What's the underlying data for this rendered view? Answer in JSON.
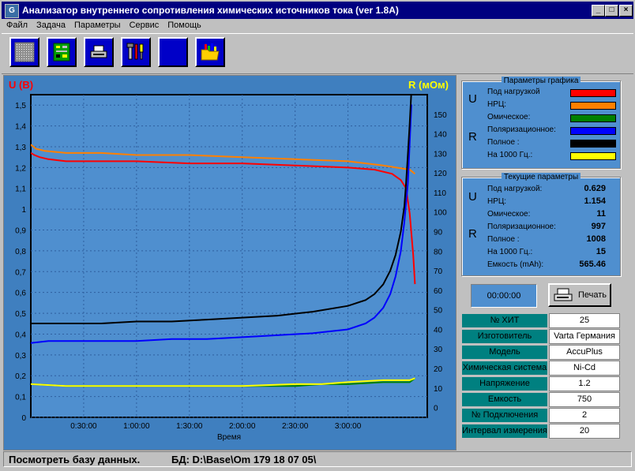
{
  "window": {
    "title": "Анализатор внутреннего сопротивления химических источников тока (ver 1.8A)",
    "min_glyph": "_",
    "max_glyph": "□",
    "close_glyph": "×"
  },
  "menu": [
    "Файл",
    "Задача",
    "Параметры",
    "Сервис",
    "Помощь"
  ],
  "toolbar": {
    "icons": [
      "pattern-icon",
      "circuit-board-icon",
      "printer-icon",
      "tools-icon",
      "blank-icon",
      "open-folder-chart-icon"
    ]
  },
  "chart_data": {
    "type": "line",
    "ylabel_left": "U (В)",
    "ylabel_right": "R (мОм)",
    "xlabel": "Время",
    "x_ticks": [
      "0:30:00",
      "1:00:00",
      "1:30:00",
      "2:00:00",
      "2:30:00",
      "3:00:00"
    ],
    "x_tick_minutes": [
      30,
      60,
      90,
      120,
      150,
      180
    ],
    "xlim_minutes": [
      0,
      225
    ],
    "y_left_ticks": [
      "0",
      "0,1",
      "0,2",
      "0,3",
      "0,4",
      "0,5",
      "0,6",
      "0,7",
      "0,8",
      "0,9",
      "1",
      "1,1",
      "1,2",
      "1,3",
      "1,4",
      "1,5"
    ],
    "y_left_values": [
      0,
      0.1,
      0.2,
      0.3,
      0.4,
      0.5,
      0.6,
      0.7,
      0.8,
      0.9,
      1.0,
      1.1,
      1.2,
      1.3,
      1.4,
      1.5
    ],
    "ylim_left": [
      0,
      1.55
    ],
    "y_right_ticks": [
      "0",
      "10",
      "20",
      "30",
      "40",
      "50",
      "60",
      "70",
      "80",
      "90",
      "100",
      "110",
      "120",
      "130",
      "140",
      "150"
    ],
    "y_right_values": [
      0,
      10,
      20,
      30,
      40,
      50,
      60,
      70,
      80,
      90,
      100,
      110,
      120,
      130,
      140,
      150
    ],
    "ylim_right": [
      -5,
      160
    ],
    "grid": true,
    "series": [
      {
        "name": "Под нагрузкой",
        "axis": "left",
        "color": "#ff0000",
        "x": [
          0,
          2,
          5,
          10,
          20,
          40,
          60,
          90,
          120,
          150,
          180,
          195,
          205,
          210,
          213,
          215,
          217,
          218
        ],
        "y": [
          1.27,
          1.26,
          1.25,
          1.24,
          1.23,
          1.23,
          1.23,
          1.22,
          1.22,
          1.21,
          1.2,
          1.19,
          1.17,
          1.14,
          1.1,
          0.98,
          0.78,
          0.64
        ]
      },
      {
        "name": "НРЦ",
        "axis": "left",
        "color": "#ff8000",
        "x": [
          0,
          3,
          8,
          20,
          40,
          60,
          90,
          120,
          150,
          180,
          200,
          215,
          218
        ],
        "y": [
          1.31,
          1.29,
          1.28,
          1.27,
          1.27,
          1.26,
          1.26,
          1.25,
          1.24,
          1.23,
          1.21,
          1.19,
          1.17
        ]
      },
      {
        "name": "Омическое",
        "axis": "right",
        "color": "#008000",
        "x": [
          0,
          20,
          40,
          60,
          90,
          120,
          150,
          165,
          180,
          200,
          215,
          218
        ],
        "y": [
          12,
          11,
          11,
          11,
          11,
          11,
          11,
          12,
          12,
          13,
          13,
          15
        ]
      },
      {
        "name": "Поляризационное",
        "axis": "right",
        "color": "#0000ff",
        "x": [
          0,
          10,
          20,
          40,
          60,
          80,
          100,
          120,
          140,
          160,
          180,
          190,
          195,
          200,
          204,
          207,
          210,
          212,
          214,
          215,
          216
        ],
        "y": [
          33,
          34,
          34,
          34,
          34,
          35,
          35,
          36,
          37,
          38,
          40,
          43,
          46,
          51,
          58,
          67,
          80,
          95,
          115,
          135,
          155
        ]
      },
      {
        "name": "Полное :",
        "axis": "right",
        "color": "#000000",
        "x": [
          0,
          10,
          20,
          40,
          60,
          80,
          100,
          120,
          140,
          160,
          180,
          190,
          195,
          200,
          204,
          207,
          210,
          212,
          213,
          214,
          215,
          216,
          217
        ],
        "y": [
          43,
          43,
          43,
          43,
          44,
          44,
          45,
          46,
          47,
          49,
          52,
          55,
          58,
          63,
          70,
          78,
          90,
          103,
          115,
          130,
          145,
          162,
          175
        ]
      },
      {
        "name": "На 1000 Гц.",
        "axis": "right",
        "color": "#ffff00",
        "x": [
          0,
          20,
          40,
          60,
          90,
          120,
          150,
          165,
          180,
          200,
          215,
          218
        ],
        "y": [
          12,
          11,
          11,
          11,
          11,
          11,
          12,
          12,
          13,
          14,
          14,
          15
        ]
      }
    ]
  },
  "params_graph": {
    "title": "Параметры графика",
    "u_letter": "U",
    "r_letter": "R",
    "items": [
      {
        "label": "Под нагрузкой",
        "color": "#ff0000"
      },
      {
        "label": "НРЦ:",
        "color": "#ff8000"
      },
      {
        "label": "Омическое:",
        "color": "#008000"
      },
      {
        "label": "Поляризационное:",
        "color": "#0000ff"
      },
      {
        "label": "Полное :",
        "color": "#000000"
      },
      {
        "label": "На 1000 Гц.:",
        "color": "#ffff00"
      }
    ]
  },
  "current_params": {
    "title": "Текущие параметры",
    "u_letter": "U",
    "r_letter": "R",
    "items": [
      {
        "label": "Под нагрузкой:",
        "value": "0.629"
      },
      {
        "label": "НРЦ:",
        "value": "1.154"
      },
      {
        "label": "Омическое:",
        "value": "11"
      },
      {
        "label": "Поляризационное:",
        "value": "997"
      },
      {
        "label": "Полное :",
        "value": "1008"
      },
      {
        "label": "На 1000 Гц.:",
        "value": "15"
      },
      {
        "label": "Емкость (mAh):",
        "value": "565.46"
      }
    ]
  },
  "timer": "00:00:00",
  "print_button": "Печать",
  "info": [
    {
      "key": "№ ХИТ",
      "value": "25"
    },
    {
      "key": "Изготовитель",
      "value": "Varta Германия"
    },
    {
      "key": "Модель",
      "value": "AccuPlus"
    },
    {
      "key": "Химическая система",
      "value": "Ni-Cd"
    },
    {
      "key": "Напряжение",
      "value": "1.2"
    },
    {
      "key": "Емкость",
      "value": "750"
    },
    {
      "key": "№ Подключения",
      "value": "2"
    },
    {
      "key": "Интервал измерения",
      "value": "20"
    }
  ],
  "status": {
    "text": "Посмотреть базу данных.",
    "db": "БД: D:\\Base\\Om 179 18 07 05\\"
  }
}
